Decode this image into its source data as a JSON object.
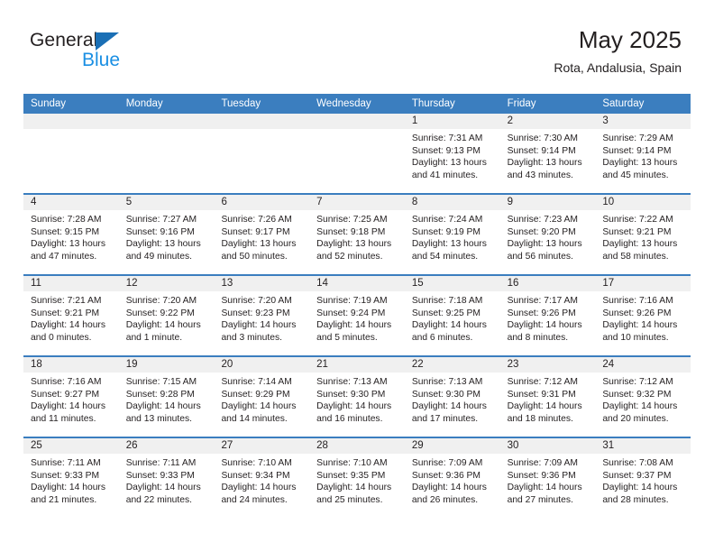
{
  "brand": {
    "name_top": "General",
    "name_bottom": "Blue",
    "accent_dark": "#1a6fb5",
    "accent_light": "#1a8fe3"
  },
  "header": {
    "title": "May 2025",
    "subtitle": "Rota, Andalusia, Spain"
  },
  "theme": {
    "header_bg": "#3b7ebf",
    "daynum_bg": "#f0f0f0",
    "rule": "#3b7ebf",
    "text": "#231f20"
  },
  "weekday_headers": [
    "Sunday",
    "Monday",
    "Tuesday",
    "Wednesday",
    "Thursday",
    "Friday",
    "Saturday"
  ],
  "weeks": [
    [
      {
        "day": "",
        "sunrise": "",
        "sunset": "",
        "daylight1": "",
        "daylight2": ""
      },
      {
        "day": "",
        "sunrise": "",
        "sunset": "",
        "daylight1": "",
        "daylight2": ""
      },
      {
        "day": "",
        "sunrise": "",
        "sunset": "",
        "daylight1": "",
        "daylight2": ""
      },
      {
        "day": "",
        "sunrise": "",
        "sunset": "",
        "daylight1": "",
        "daylight2": ""
      },
      {
        "day": "1",
        "sunrise": "Sunrise: 7:31 AM",
        "sunset": "Sunset: 9:13 PM",
        "daylight1": "Daylight: 13 hours",
        "daylight2": "and 41 minutes."
      },
      {
        "day": "2",
        "sunrise": "Sunrise: 7:30 AM",
        "sunset": "Sunset: 9:14 PM",
        "daylight1": "Daylight: 13 hours",
        "daylight2": "and 43 minutes."
      },
      {
        "day": "3",
        "sunrise": "Sunrise: 7:29 AM",
        "sunset": "Sunset: 9:14 PM",
        "daylight1": "Daylight: 13 hours",
        "daylight2": "and 45 minutes."
      }
    ],
    [
      {
        "day": "4",
        "sunrise": "Sunrise: 7:28 AM",
        "sunset": "Sunset: 9:15 PM",
        "daylight1": "Daylight: 13 hours",
        "daylight2": "and 47 minutes."
      },
      {
        "day": "5",
        "sunrise": "Sunrise: 7:27 AM",
        "sunset": "Sunset: 9:16 PM",
        "daylight1": "Daylight: 13 hours",
        "daylight2": "and 49 minutes."
      },
      {
        "day": "6",
        "sunrise": "Sunrise: 7:26 AM",
        "sunset": "Sunset: 9:17 PM",
        "daylight1": "Daylight: 13 hours",
        "daylight2": "and 50 minutes."
      },
      {
        "day": "7",
        "sunrise": "Sunrise: 7:25 AM",
        "sunset": "Sunset: 9:18 PM",
        "daylight1": "Daylight: 13 hours",
        "daylight2": "and 52 minutes."
      },
      {
        "day": "8",
        "sunrise": "Sunrise: 7:24 AM",
        "sunset": "Sunset: 9:19 PM",
        "daylight1": "Daylight: 13 hours",
        "daylight2": "and 54 minutes."
      },
      {
        "day": "9",
        "sunrise": "Sunrise: 7:23 AM",
        "sunset": "Sunset: 9:20 PM",
        "daylight1": "Daylight: 13 hours",
        "daylight2": "and 56 minutes."
      },
      {
        "day": "10",
        "sunrise": "Sunrise: 7:22 AM",
        "sunset": "Sunset: 9:21 PM",
        "daylight1": "Daylight: 13 hours",
        "daylight2": "and 58 minutes."
      }
    ],
    [
      {
        "day": "11",
        "sunrise": "Sunrise: 7:21 AM",
        "sunset": "Sunset: 9:21 PM",
        "daylight1": "Daylight: 14 hours",
        "daylight2": "and 0 minutes."
      },
      {
        "day": "12",
        "sunrise": "Sunrise: 7:20 AM",
        "sunset": "Sunset: 9:22 PM",
        "daylight1": "Daylight: 14 hours",
        "daylight2": "and 1 minute."
      },
      {
        "day": "13",
        "sunrise": "Sunrise: 7:20 AM",
        "sunset": "Sunset: 9:23 PM",
        "daylight1": "Daylight: 14 hours",
        "daylight2": "and 3 minutes."
      },
      {
        "day": "14",
        "sunrise": "Sunrise: 7:19 AM",
        "sunset": "Sunset: 9:24 PM",
        "daylight1": "Daylight: 14 hours",
        "daylight2": "and 5 minutes."
      },
      {
        "day": "15",
        "sunrise": "Sunrise: 7:18 AM",
        "sunset": "Sunset: 9:25 PM",
        "daylight1": "Daylight: 14 hours",
        "daylight2": "and 6 minutes."
      },
      {
        "day": "16",
        "sunrise": "Sunrise: 7:17 AM",
        "sunset": "Sunset: 9:26 PM",
        "daylight1": "Daylight: 14 hours",
        "daylight2": "and 8 minutes."
      },
      {
        "day": "17",
        "sunrise": "Sunrise: 7:16 AM",
        "sunset": "Sunset: 9:26 PM",
        "daylight1": "Daylight: 14 hours",
        "daylight2": "and 10 minutes."
      }
    ],
    [
      {
        "day": "18",
        "sunrise": "Sunrise: 7:16 AM",
        "sunset": "Sunset: 9:27 PM",
        "daylight1": "Daylight: 14 hours",
        "daylight2": "and 11 minutes."
      },
      {
        "day": "19",
        "sunrise": "Sunrise: 7:15 AM",
        "sunset": "Sunset: 9:28 PM",
        "daylight1": "Daylight: 14 hours",
        "daylight2": "and 13 minutes."
      },
      {
        "day": "20",
        "sunrise": "Sunrise: 7:14 AM",
        "sunset": "Sunset: 9:29 PM",
        "daylight1": "Daylight: 14 hours",
        "daylight2": "and 14 minutes."
      },
      {
        "day": "21",
        "sunrise": "Sunrise: 7:13 AM",
        "sunset": "Sunset: 9:30 PM",
        "daylight1": "Daylight: 14 hours",
        "daylight2": "and 16 minutes."
      },
      {
        "day": "22",
        "sunrise": "Sunrise: 7:13 AM",
        "sunset": "Sunset: 9:30 PM",
        "daylight1": "Daylight: 14 hours",
        "daylight2": "and 17 minutes."
      },
      {
        "day": "23",
        "sunrise": "Sunrise: 7:12 AM",
        "sunset": "Sunset: 9:31 PM",
        "daylight1": "Daylight: 14 hours",
        "daylight2": "and 18 minutes."
      },
      {
        "day": "24",
        "sunrise": "Sunrise: 7:12 AM",
        "sunset": "Sunset: 9:32 PM",
        "daylight1": "Daylight: 14 hours",
        "daylight2": "and 20 minutes."
      }
    ],
    [
      {
        "day": "25",
        "sunrise": "Sunrise: 7:11 AM",
        "sunset": "Sunset: 9:33 PM",
        "daylight1": "Daylight: 14 hours",
        "daylight2": "and 21 minutes."
      },
      {
        "day": "26",
        "sunrise": "Sunrise: 7:11 AM",
        "sunset": "Sunset: 9:33 PM",
        "daylight1": "Daylight: 14 hours",
        "daylight2": "and 22 minutes."
      },
      {
        "day": "27",
        "sunrise": "Sunrise: 7:10 AM",
        "sunset": "Sunset: 9:34 PM",
        "daylight1": "Daylight: 14 hours",
        "daylight2": "and 24 minutes."
      },
      {
        "day": "28",
        "sunrise": "Sunrise: 7:10 AM",
        "sunset": "Sunset: 9:35 PM",
        "daylight1": "Daylight: 14 hours",
        "daylight2": "and 25 minutes."
      },
      {
        "day": "29",
        "sunrise": "Sunrise: 7:09 AM",
        "sunset": "Sunset: 9:36 PM",
        "daylight1": "Daylight: 14 hours",
        "daylight2": "and 26 minutes."
      },
      {
        "day": "30",
        "sunrise": "Sunrise: 7:09 AM",
        "sunset": "Sunset: 9:36 PM",
        "daylight1": "Daylight: 14 hours",
        "daylight2": "and 27 minutes."
      },
      {
        "day": "31",
        "sunrise": "Sunrise: 7:08 AM",
        "sunset": "Sunset: 9:37 PM",
        "daylight1": "Daylight: 14 hours",
        "daylight2": "and 28 minutes."
      }
    ]
  ]
}
